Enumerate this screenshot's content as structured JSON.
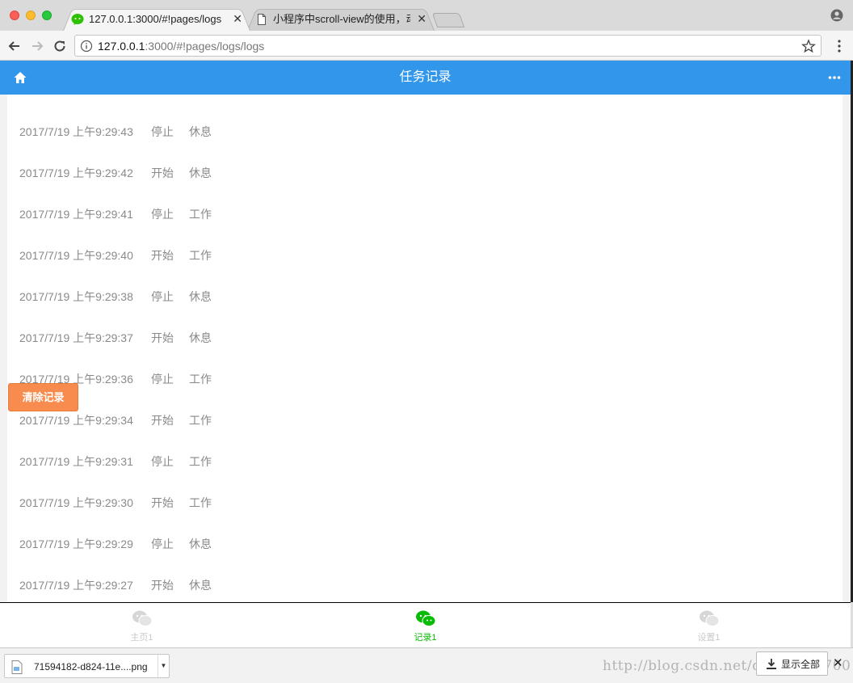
{
  "browser": {
    "tabs": [
      {
        "label": "127.0.0.1:3000/#!pages/logs",
        "active": true,
        "icon": "wechat-icon"
      },
      {
        "label": "小程序中scroll-view的使用，动态",
        "active": false,
        "icon": "document-icon"
      }
    ],
    "address": {
      "host": "127.0.0.1",
      "rest": ":3000/#!pages/logs/logs"
    }
  },
  "app": {
    "title": "任务记录",
    "logs": [
      {
        "time": "2017/7/19 上午9:29:43",
        "action": "停止",
        "type": "休息"
      },
      {
        "time": "2017/7/19 上午9:29:42",
        "action": "开始",
        "type": "休息"
      },
      {
        "time": "2017/7/19 上午9:29:41",
        "action": "停止",
        "type": "工作"
      },
      {
        "time": "2017/7/19 上午9:29:40",
        "action": "开始",
        "type": "工作"
      },
      {
        "time": "2017/7/19 上午9:29:38",
        "action": "停止",
        "type": "休息"
      },
      {
        "time": "2017/7/19 上午9:29:37",
        "action": "开始",
        "type": "休息"
      },
      {
        "time": "2017/7/19 上午9:29:36",
        "action": "停止",
        "type": "工作"
      },
      {
        "time": "2017/7/19 上午9:29:34",
        "action": "开始",
        "type": "工作"
      },
      {
        "time": "2017/7/19 上午9:29:31",
        "action": "停止",
        "type": "工作"
      },
      {
        "time": "2017/7/19 上午9:29:30",
        "action": "开始",
        "type": "工作"
      },
      {
        "time": "2017/7/19 上午9:29:29",
        "action": "停止",
        "type": "休息"
      },
      {
        "time": "2017/7/19 上午9:29:27",
        "action": "开始",
        "type": "休息"
      }
    ],
    "clear_button": "清除记录",
    "tabbar": [
      {
        "label": "主页1",
        "active": false
      },
      {
        "label": "记录1",
        "active": true
      },
      {
        "label": "设置1",
        "active": false
      }
    ]
  },
  "downloads": {
    "file": "71594182-d824-11e....png",
    "show_all": "显示全部",
    "watermark": "http://blog.csdn.net/qq_35713700"
  },
  "colors": {
    "navbar": "#3296ea",
    "clear_button": "#f78c4e",
    "tab_active": "#09bb07",
    "tab_inactive": "#c9c9c9"
  }
}
